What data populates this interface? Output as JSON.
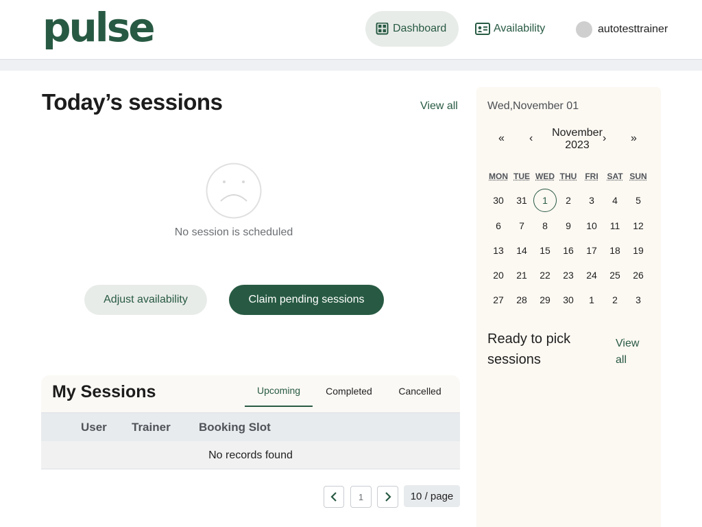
{
  "header": {
    "logo": "pulse",
    "nav": [
      {
        "label": "Dashboard",
        "icon": "dashboard-grid-icon",
        "active": true
      },
      {
        "label": "Availability",
        "icon": "id-card-icon",
        "active": false
      }
    ],
    "username": "autotesttrainer"
  },
  "today": {
    "title": "Today’s sessions",
    "view_all": "View all",
    "empty_icon": "sad-face-icon",
    "empty_text": "No session is scheduled",
    "adjust_button": "Adjust availability",
    "claim_button": "Claim pending sessions"
  },
  "my_sessions": {
    "title": "My Sessions",
    "tabs": [
      "Upcoming",
      "Completed",
      "Cancelled"
    ],
    "active_tab": "Upcoming",
    "columns": [
      "User",
      "Trainer",
      "Booking Slot"
    ],
    "empty_text": "No records found",
    "pagination": {
      "current_page": "1",
      "page_size": "10 / page"
    }
  },
  "calendar": {
    "selected_date": "Wed,November 01",
    "nav": {
      "prev_year": "«",
      "prev_month": "‹",
      "next_month": "›",
      "next_year": "»"
    },
    "month": "November",
    "year": "2023",
    "weekdays": [
      "MON",
      "TUE",
      "WED",
      "THU",
      "FRI",
      "SAT",
      "SUN"
    ],
    "weeks": [
      [
        "30",
        "31",
        "1",
        "2",
        "3",
        "4",
        "5"
      ],
      [
        "6",
        "7",
        "8",
        "9",
        "10",
        "11",
        "12"
      ],
      [
        "13",
        "14",
        "15",
        "16",
        "17",
        "18",
        "19"
      ],
      [
        "20",
        "21",
        "22",
        "23",
        "24",
        "25",
        "26"
      ],
      [
        "27",
        "28",
        "29",
        "30",
        "1",
        "2",
        "3"
      ]
    ],
    "selected_day": "1",
    "ready_title": "Ready to pick sessions",
    "ready_link": "View all"
  },
  "colors": {
    "brand": "#285a43",
    "panel_bg": "#fcf8f2",
    "table_head_bg": "#e8ebee"
  }
}
